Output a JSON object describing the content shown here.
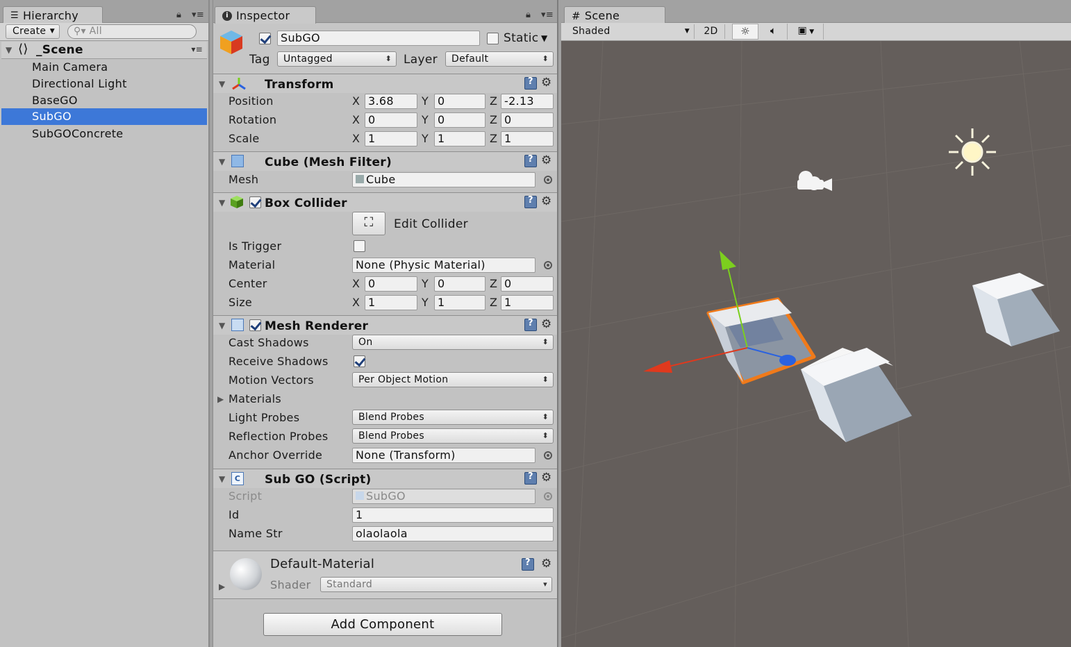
{
  "hierarchy": {
    "tab_label": "Hierarchy",
    "create_label": "Create",
    "search_placeholder": "All",
    "scene_name": "_Scene",
    "items": [
      {
        "label": "Main Camera",
        "selected": false
      },
      {
        "label": "Directional Light",
        "selected": false
      },
      {
        "label": "BaseGO",
        "selected": false
      },
      {
        "label": "SubGO",
        "selected": true
      },
      {
        "label": "SubGOConcrete",
        "selected": false
      }
    ]
  },
  "inspector": {
    "tab_label": "Inspector",
    "object_name": "SubGO",
    "active": true,
    "static_label": "Static",
    "static_checked": false,
    "tag_label": "Tag",
    "tag_value": "Untagged",
    "layer_label": "Layer",
    "layer_value": "Default",
    "axis": {
      "x": "X",
      "y": "Y",
      "z": "Z"
    },
    "transform": {
      "title": "Transform",
      "position_label": "Position",
      "rotation_label": "Rotation",
      "scale_label": "Scale",
      "position": {
        "x": "3.68",
        "y": "0",
        "z": "-2.13"
      },
      "rotation": {
        "x": "0",
        "y": "0",
        "z": "0"
      },
      "scale": {
        "x": "1",
        "y": "1",
        "z": "1"
      }
    },
    "mesh_filter": {
      "title": "Cube (Mesh Filter)",
      "mesh_label": "Mesh",
      "mesh_value": "Cube"
    },
    "box_collider": {
      "title": "Box Collider",
      "enabled": true,
      "edit_collider_label": "Edit Collider",
      "is_trigger_label": "Is Trigger",
      "is_trigger": false,
      "material_label": "Material",
      "material_value": "None (Physic Material)",
      "center_label": "Center",
      "center": {
        "x": "0",
        "y": "0",
        "z": "0"
      },
      "size_label": "Size",
      "size": {
        "x": "1",
        "y": "1",
        "z": "1"
      }
    },
    "mesh_renderer": {
      "title": "Mesh Renderer",
      "enabled": true,
      "cast_shadows_label": "Cast Shadows",
      "cast_shadows_value": "On",
      "receive_shadows_label": "Receive Shadows",
      "receive_shadows": true,
      "motion_vectors_label": "Motion Vectors",
      "motion_vectors_value": "Per Object Motion",
      "materials_label": "Materials",
      "light_probes_label": "Light Probes",
      "light_probes_value": "Blend Probes",
      "reflection_probes_label": "Reflection Probes",
      "reflection_probes_value": "Blend Probes",
      "anchor_override_label": "Anchor Override",
      "anchor_override_value": "None (Transform)"
    },
    "script": {
      "title": "Sub GO (Script)",
      "script_label": "Script",
      "script_value": "SubGO",
      "id_label": "Id",
      "id_value": "1",
      "name_str_label": "Name Str",
      "name_str_value": "olaolaola"
    },
    "material": {
      "name": "Default-Material",
      "shader_label": "Shader",
      "shader_value": "Standard"
    },
    "add_component_label": "Add Component"
  },
  "scene": {
    "tab_label": "Scene",
    "shading_mode": "Shaded",
    "mode_2d_label": "2D"
  },
  "colors": {
    "selection": "#3d78d8",
    "scene_bg": "#645e5b",
    "panel_bg": "#c2c2c2",
    "selection_outline": "#f07a1a",
    "axis_x": "#e0391d",
    "axis_y": "#7ccf1e",
    "axis_z": "#2a62e0"
  }
}
